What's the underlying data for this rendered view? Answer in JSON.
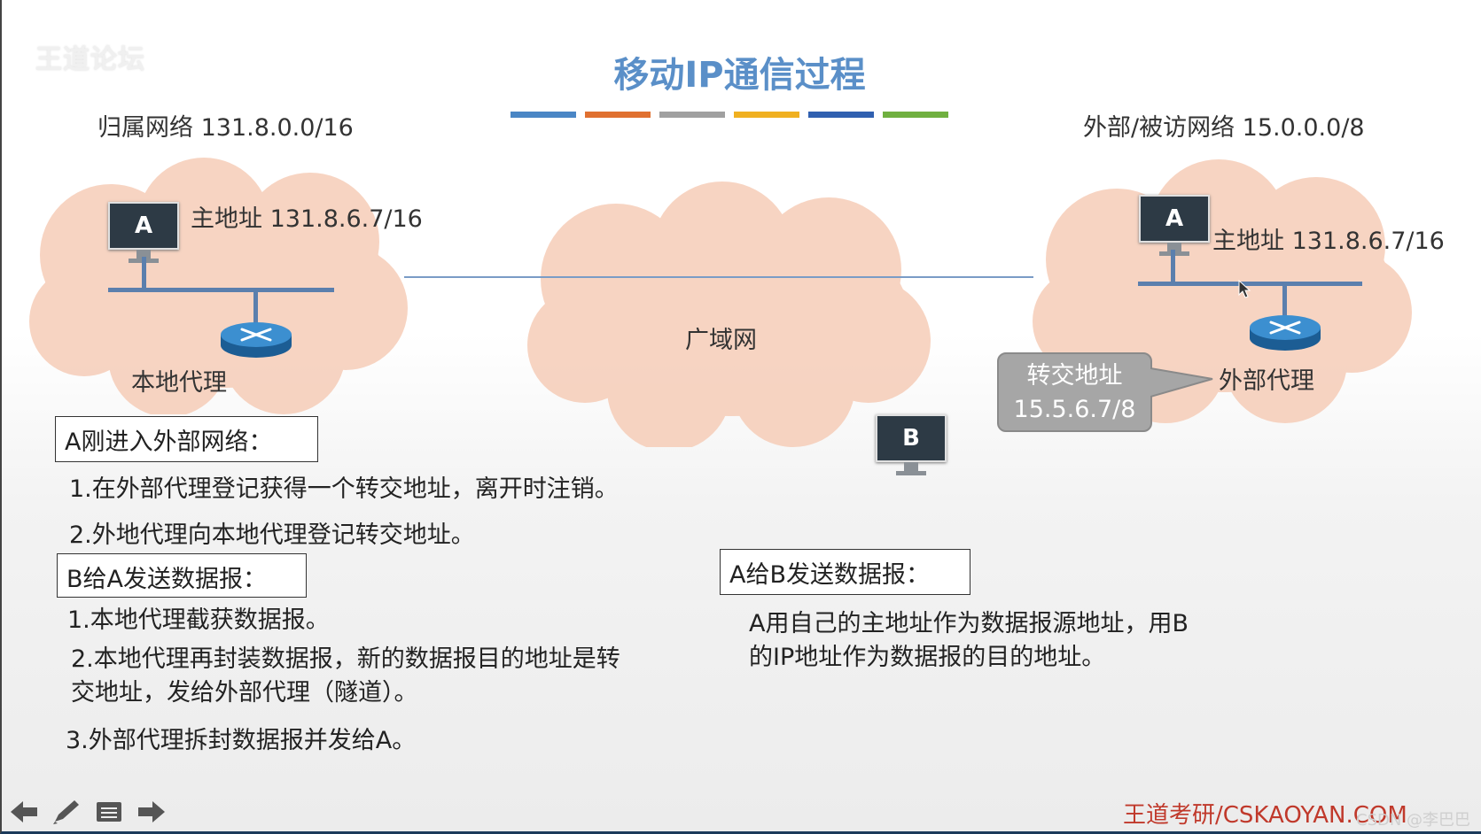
{
  "watermark": "王道论坛",
  "title": "移动IP通信过程",
  "color_bars": [
    "#4a86c5",
    "#e07030",
    "#a0a0a0",
    "#f0b020",
    "#3060b0",
    "#70b040"
  ],
  "home_network": "归属网络 131.8.0.0/16",
  "foreign_network": "外部/被访网络 15.0.0.0/8",
  "home": {
    "host_label": "A",
    "host_address": "主地址 131.8.6.7/16",
    "agent": "本地代理"
  },
  "foreign": {
    "host_label": "A",
    "host_address": "主地址 131.8.6.7/16",
    "agent": "外部代理"
  },
  "wan": "广域网",
  "care_of": {
    "line1": "转交地址",
    "line2": "15.5.6.7/8"
  },
  "host_b": "B",
  "section1": {
    "heading": "A刚进入外部网络：",
    "steps": [
      "1.在外部代理登记获得一个转交地址，离开时注销。",
      "2.外地代理向本地代理登记转交地址。"
    ]
  },
  "section2": {
    "heading": "B给A发送数据报：",
    "steps": [
      "1.本地代理截获数据报。",
      "2.本地代理再封装数据报，新的数据报目的地址是转",
      "交地址，发给外部代理（隧道）。",
      "3.外部代理拆封数据报并发给A。"
    ]
  },
  "section3": {
    "heading": "A给B发送数据报：",
    "lines": [
      "A用自己的主地址作为数据报源地址，用B",
      "的IP地址作为数据报的目的地址。"
    ]
  },
  "footer": "王道考研/CSKAOYAN.COM",
  "csdn": "CSDN @李巴巴",
  "nav_icons": [
    "back-arrow-icon",
    "pen-icon",
    "menu-icon",
    "forward-arrow-icon"
  ]
}
